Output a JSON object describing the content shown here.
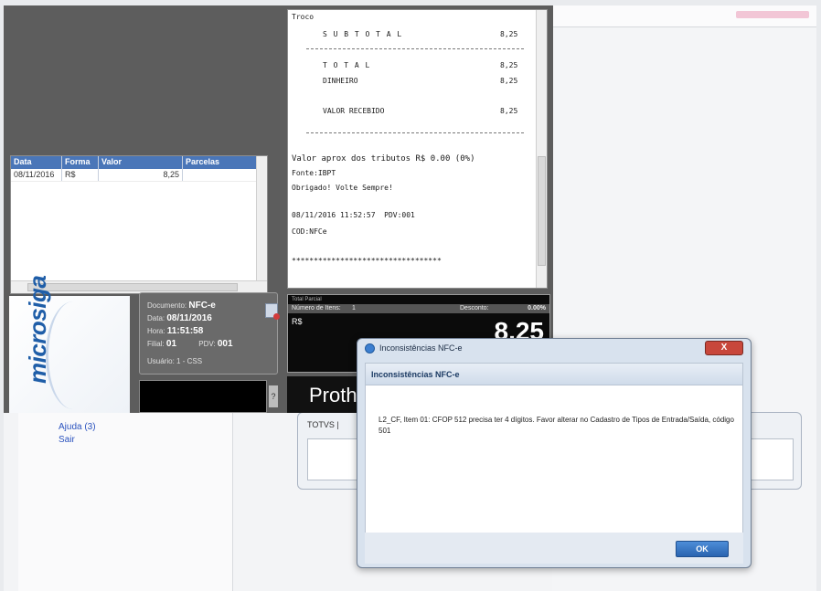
{
  "sidebar_links": {
    "help": "Ajuda (3)",
    "exit": "Sair"
  },
  "grid": {
    "columns": [
      "Data",
      "Forma",
      "Valor",
      "Parcelas"
    ],
    "rows": [
      {
        "date": "08/11/2016",
        "form": "R$",
        "value": "8,25",
        "installments": ""
      }
    ]
  },
  "receipt": {
    "troco_label": "Troco",
    "subtotal_label": "S U B T O T A L",
    "subtotal_value": "8,25",
    "total_label": "T O T A L",
    "total_value": "8,25",
    "cash_label": "DINHEIRO",
    "cash_value": "8,25",
    "received_label": "VALOR RECEBIDO",
    "received_value": "8,25",
    "taxes_line": "Valor aprox dos tributos R$ 0.00 (0%)",
    "source_line": "Fonte:IBPT",
    "thanks_line": "Obrigado! Volte Sempre!",
    "datetime_pdv": "08/11/2016 11:52:57  PDV:001",
    "cod_line": "COD:NFCe",
    "stars": "**********************************"
  },
  "logo": "microsiga",
  "document": {
    "doc_label": "Documento:",
    "doc_value": "NFC-e",
    "date_label": "Data:",
    "date_value": "08/11/2016",
    "time_label": "Hora:",
    "time_value": "11:51:58",
    "branch_label": "Filial:",
    "branch_value": "01",
    "pdv_label": "PDV:",
    "pdv_value": "001",
    "user_label": "Usuário:",
    "user_value": "1 - CSS"
  },
  "totals": {
    "header": "Total Parcial",
    "items_label": "Número de Itens:",
    "items_value": "1",
    "discount_label": "Desconto:",
    "discount_value": "0.00%",
    "currency": "R$",
    "amount": "8,25"
  },
  "proth_text": "Proth",
  "totvs_title": "TOTVS |",
  "dialog": {
    "title": "Inconsistências NFC-e",
    "close_label": "X",
    "header": "Inconsistências NFC-e",
    "message": "L2_CF, Item 01: CFOP 512 precisa ter 4 dígitos. Favor alterar no Cadastro de Tipos de Entrada/Saída, código 501",
    "ok_label": "OK"
  }
}
